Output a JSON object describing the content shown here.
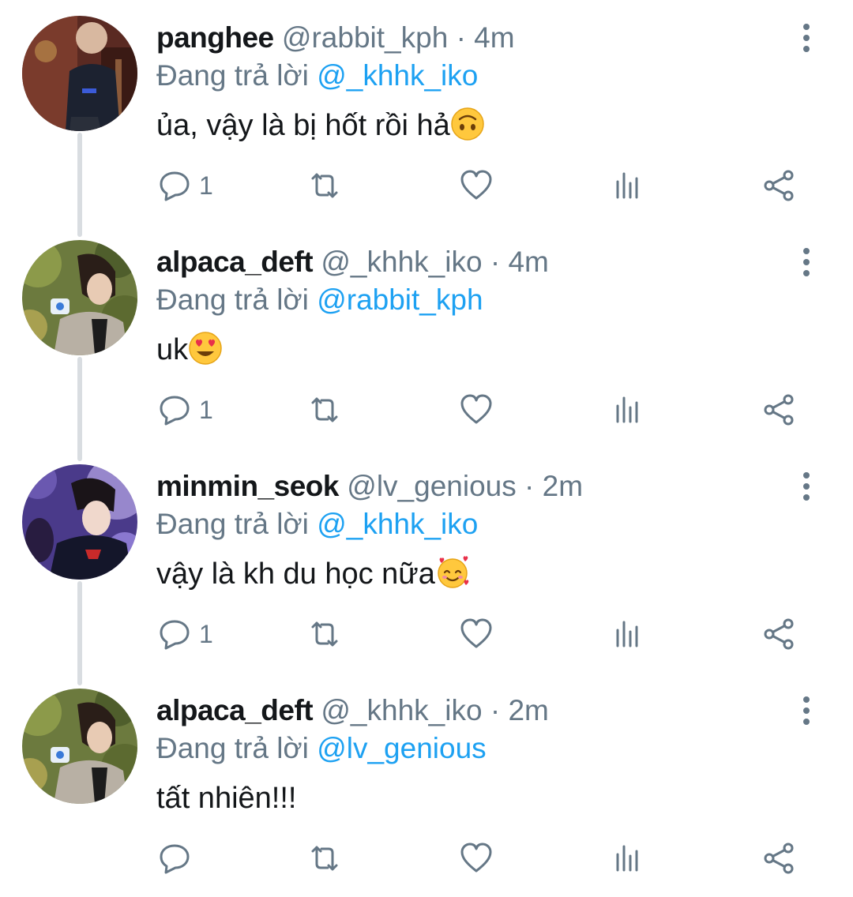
{
  "colors": {
    "text": "#14171a",
    "secondary": "#657786",
    "mention": "#1da1f2",
    "thread_line": "#d9dde1"
  },
  "tweets": [
    {
      "name": "panghee",
      "handle": "@rabbit_kph",
      "separator": "·",
      "time": "4m",
      "replying_prefix": "Đang trả lời",
      "replying_to": "@_khhk_iko",
      "text": "ủa, vậy là bị hốt rồi hả",
      "emoji": "upside-down-face",
      "reply_count": "1",
      "avatar": "panghee-avatar"
    },
    {
      "name": "alpaca_deft",
      "handle": "@_khhk_iko",
      "separator": "·",
      "time": "4m",
      "replying_prefix": "Đang trả lời",
      "replying_to": "@rabbit_kph",
      "text": "uk",
      "emoji": "heart-eyes-face",
      "reply_count": "1",
      "avatar": "alpaca-deft-avatar"
    },
    {
      "name": "minmin_seok",
      "handle": "@lv_genious",
      "separator": "·",
      "time": "2m",
      "replying_prefix": "Đang trả lời",
      "replying_to": "@_khhk_iko",
      "text": "vậy là kh du học nữa",
      "emoji": "smiling-face-with-hearts",
      "reply_count": "1",
      "avatar": "minmin-seok-avatar"
    },
    {
      "name": "alpaca_deft",
      "handle": "@_khhk_iko",
      "separator": "·",
      "time": "2m",
      "replying_prefix": "Đang trả lời",
      "replying_to": "@lv_genious",
      "text": "tất nhiên!!!",
      "emoji": "",
      "reply_count": "",
      "avatar": "alpaca-deft-avatar"
    }
  ],
  "icons": {
    "more": "more-vertical-icon",
    "reply": "reply-bubble-icon",
    "retweet": "retweet-icon",
    "like": "heart-icon",
    "stats": "analytics-icon",
    "share": "share-icon"
  }
}
